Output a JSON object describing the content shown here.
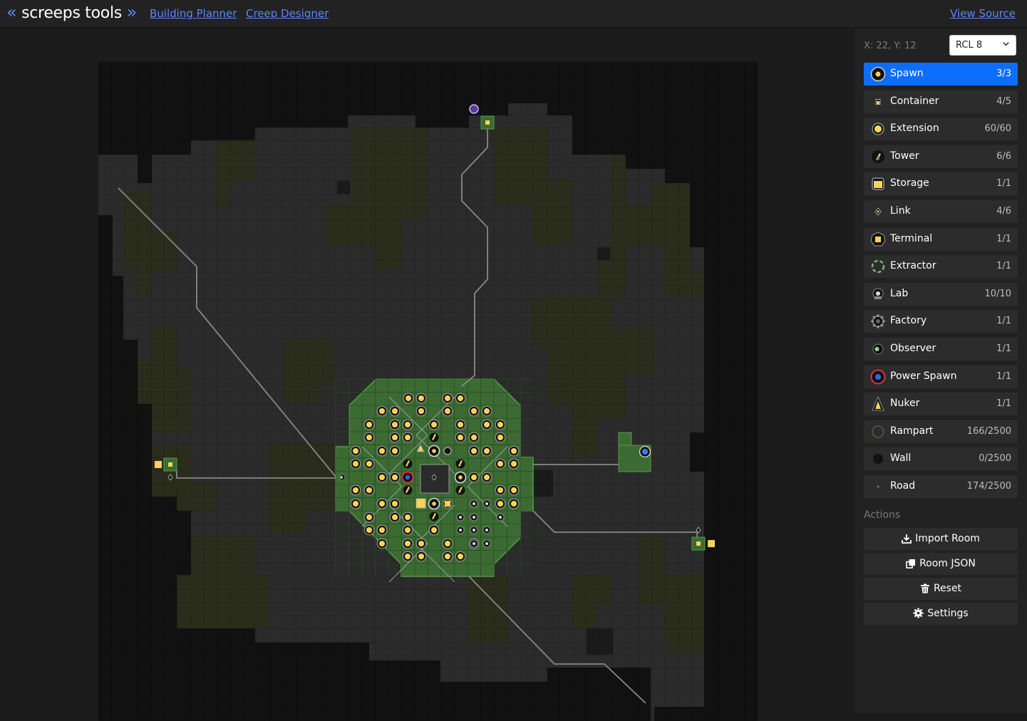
{
  "header": {
    "brand_prefix": "«",
    "brand_name": "screeps tools",
    "brand_suffix": "»",
    "nav": [
      "Building Planner",
      "Creep Designer"
    ],
    "view_source": "View Source"
  },
  "sidebar": {
    "coords": "X: 22, Y: 12",
    "rcl_selected": "RCL 8",
    "structures": [
      {
        "label": "Spawn",
        "count": "3/3",
        "active": true,
        "icon": "spawn-icon"
      },
      {
        "label": "Container",
        "count": "4/5",
        "icon": "container-icon"
      },
      {
        "label": "Extension",
        "count": "60/60",
        "icon": "extension-icon"
      },
      {
        "label": "Tower",
        "count": "6/6",
        "icon": "tower-icon"
      },
      {
        "label": "Storage",
        "count": "1/1",
        "icon": "storage-icon"
      },
      {
        "label": "Link",
        "count": "4/6",
        "icon": "link-icon"
      },
      {
        "label": "Terminal",
        "count": "1/1",
        "icon": "terminal-icon"
      },
      {
        "label": "Extractor",
        "count": "1/1",
        "icon": "extractor-icon"
      },
      {
        "label": "Lab",
        "count": "10/10",
        "icon": "lab-icon"
      },
      {
        "label": "Factory",
        "count": "1/1",
        "icon": "factory-icon"
      },
      {
        "label": "Observer",
        "count": "1/1",
        "icon": "observer-icon"
      },
      {
        "label": "Power Spawn",
        "count": "1/1",
        "icon": "power-spawn-icon"
      },
      {
        "label": "Nuker",
        "count": "1/1",
        "icon": "nuker-icon"
      },
      {
        "label": "Rampart",
        "count": "166/2500",
        "icon": "rampart-icon"
      },
      {
        "label": "Wall",
        "count": "0/2500",
        "icon": "wall-icon"
      },
      {
        "label": "Road",
        "count": "174/2500",
        "icon": "road-icon"
      }
    ],
    "actions_label": "Actions",
    "actions": [
      {
        "label": "Import Room",
        "icon": "download-icon"
      },
      {
        "label": "Room JSON",
        "icon": "copy-icon"
      },
      {
        "label": "Reset",
        "icon": "trash-icon"
      },
      {
        "label": "Settings",
        "icon": "gear-icon"
      }
    ]
  },
  "colors": {
    "active": "#0d6efd",
    "link": "#5b87ff",
    "plain": "#2b2b2b",
    "swamp": "#2a2c1c",
    "wall": "#111111",
    "rampart": "#3b6b32",
    "energy": "#f5d35a"
  }
}
